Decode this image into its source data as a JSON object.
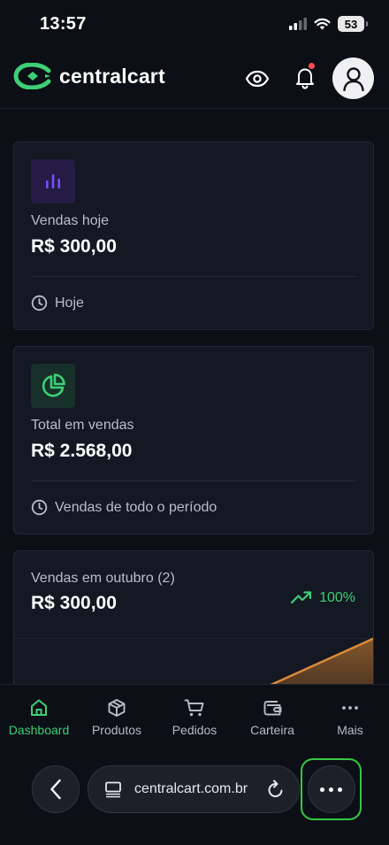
{
  "status_bar": {
    "time": "13:57",
    "battery": "53",
    "signal_icon": "cellular-signal-icon",
    "wifi_icon": "wifi-icon"
  },
  "header": {
    "logo_text": "centralcart",
    "logo_icon": "centralcart-logo-icon",
    "eye_icon": "eye-icon",
    "bell_icon": "bell-icon",
    "avatar_icon": "user-icon"
  },
  "cards": [
    {
      "icon": "bar-chart-icon",
      "label": "Vendas hoje",
      "value": "R$ 300,00",
      "footer_icon": "clock-icon",
      "footer": "Hoje"
    },
    {
      "icon": "pie-chart-icon",
      "label": "Total em vendas",
      "value": "R$ 2.568,00",
      "footer_icon": "clock-icon",
      "footer": "Vendas de todo o período"
    }
  ],
  "monthly_card": {
    "label": "Vendas em outubro (2)",
    "value": "R$ 300,00",
    "trend_icon": "trending-up-icon",
    "trend": "100%"
  },
  "chart_data": {
    "type": "area",
    "series": [
      {
        "values": [
          0,
          300
        ]
      }
    ]
  },
  "tabs": [
    {
      "label": "Dashboard",
      "icon": "home-icon",
      "active": true
    },
    {
      "label": "Produtos",
      "icon": "box-icon",
      "active": false
    },
    {
      "label": "Pedidos",
      "icon": "cart-icon",
      "active": false
    },
    {
      "label": "Carteira",
      "icon": "wallet-icon",
      "active": false
    },
    {
      "label": "Mais",
      "icon": "more-horizontal-icon",
      "active": false
    }
  ],
  "browser": {
    "url": "centralcart.com.br",
    "back_icon": "chevron-left-icon",
    "tabs_icon": "page-menu-icon",
    "reload_icon": "reload-icon",
    "more_icon": "more-icon"
  },
  "colors": {
    "background": "#0c0f16",
    "card": "#141822",
    "accent_green": "#3ecf76",
    "accent_purple": "#7b4dff",
    "chart_line": "#d98a3a"
  }
}
